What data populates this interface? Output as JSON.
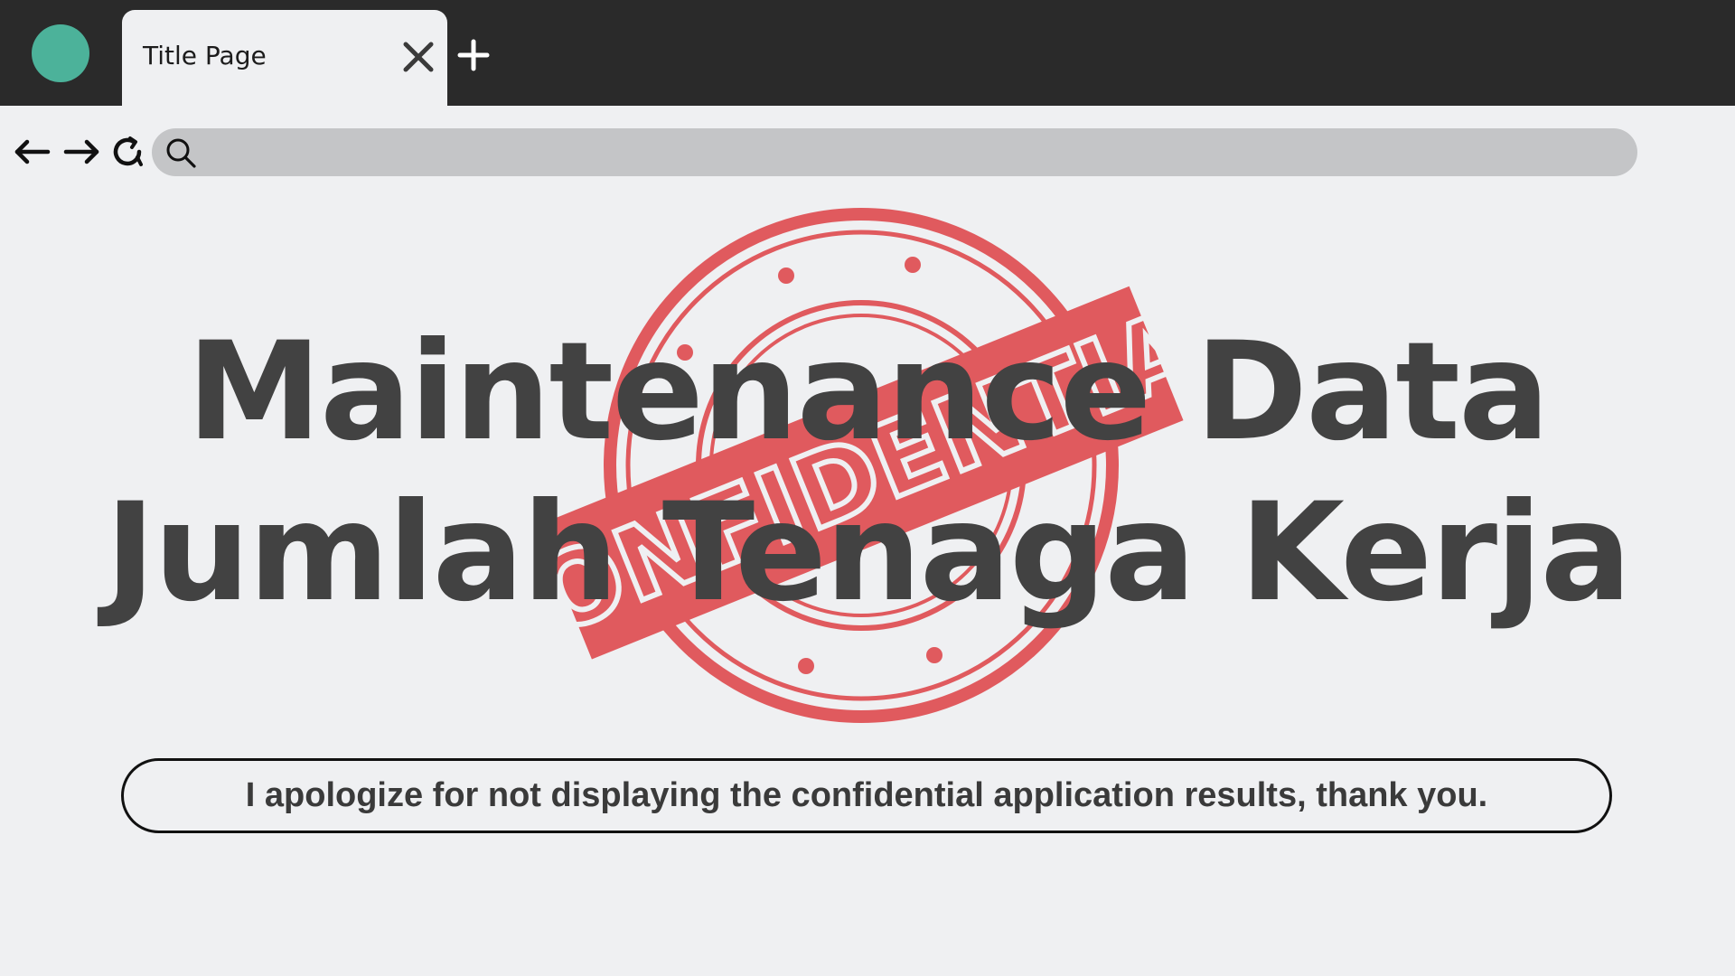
{
  "browser": {
    "tab": {
      "title": "Title Page"
    },
    "icons": {
      "profile": "profile-dot-icon",
      "close": "close-icon",
      "new_tab": "plus-icon",
      "back": "arrow-left-icon",
      "forward": "arrow-right-icon",
      "reload": "reload-icon",
      "search": "search-icon"
    },
    "address_bar": {
      "value": "",
      "placeholder": ""
    }
  },
  "content": {
    "headline_line1": "Maintenance Data",
    "headline_line2": "Jumlah Tenaga Kerja",
    "stamp_text": "CONFIDENTIAL",
    "message": "I apologize for not displaying the confidential application results, thank you."
  },
  "colors": {
    "tabstrip": "#2a2a2a",
    "page_background": "#eff0f2",
    "profile_dot": "#4cb29a",
    "address_bar": "#c4c5c7",
    "stamp": "#e05a5e",
    "headline": "#424242"
  }
}
